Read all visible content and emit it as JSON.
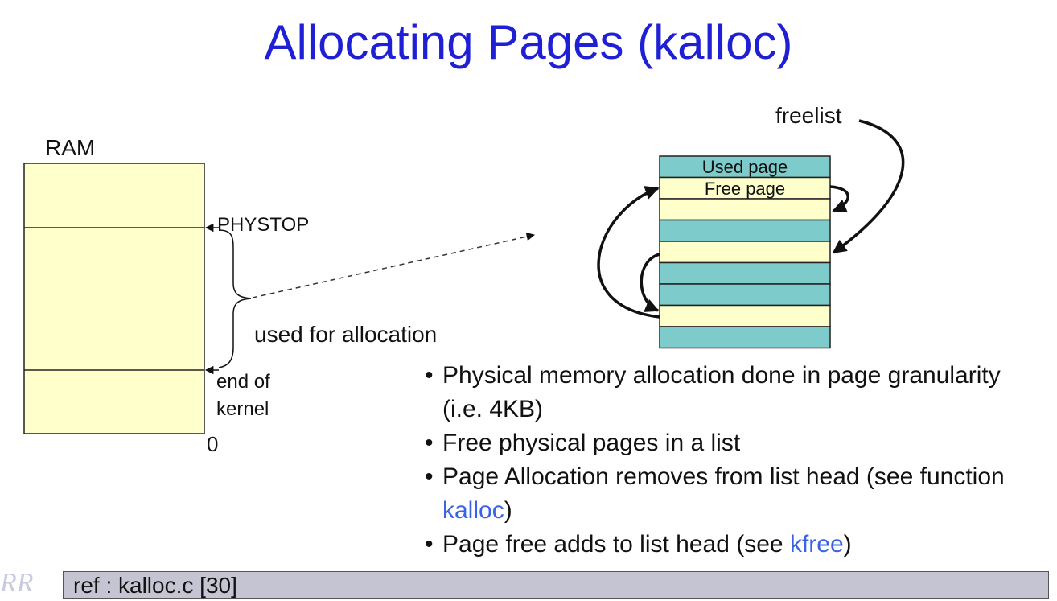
{
  "title": "Allocating Pages (kalloc)",
  "ram": {
    "label": "RAM",
    "phystop": "PHYSTOP",
    "used_for_allocation": "used for allocation",
    "end_of": "end of",
    "kernel": "kernel",
    "zero": "0"
  },
  "freelist": {
    "label": "freelist",
    "used_page": "Used page",
    "free_page": "Free page",
    "page_states": [
      "used",
      "free",
      "free",
      "used",
      "free",
      "used",
      "used",
      "free",
      "used"
    ]
  },
  "bullets": [
    {
      "text": "Physical memory allocation done in page granularity (i.e. 4KB)"
    },
    {
      "text": "Free physical pages in a list"
    },
    {
      "pre": "Page Allocation removes from list head (see function ",
      "link": "kalloc",
      "post": ")"
    },
    {
      "pre": "Page free adds to list head (see ",
      "link": "kfree",
      "post": ")"
    }
  ],
  "ref": "ref : kalloc.c [30]",
  "logo": "RR",
  "colors": {
    "title": "#1f1fd6",
    "used": "#7ecbcb",
    "free": "#ffffcc",
    "link": "#3a62e6"
  }
}
